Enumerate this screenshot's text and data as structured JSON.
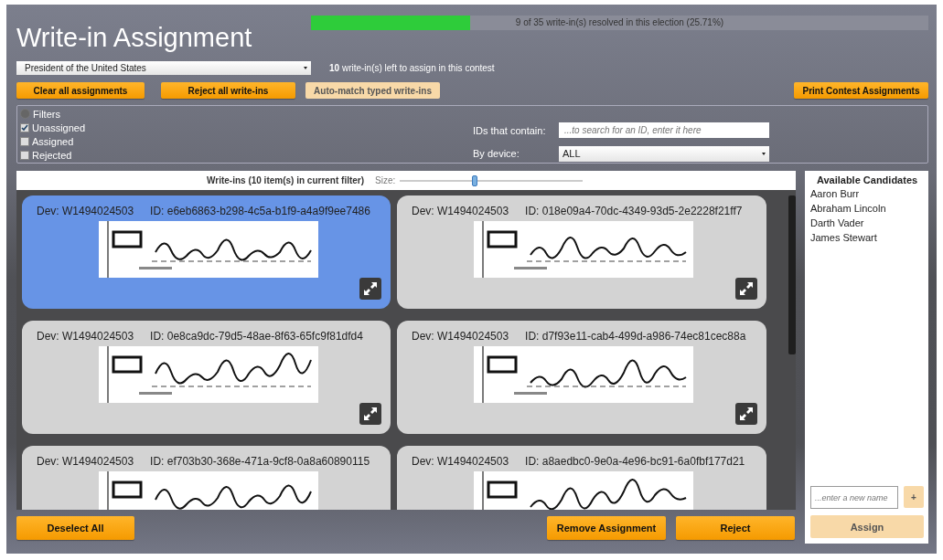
{
  "title": "Write-in Assignment",
  "progress": {
    "level": 0.2571,
    "label": "9 of 35 write-in(s) resolved in this election (25.71%)"
  },
  "contest": {
    "value": "President of the United States"
  },
  "remaining": "**10** write-in(s) left to assign in this contest",
  "actions": [
    {
      "label": "Clear all assignments",
      "disabled": false
    },
    {
      "label": "Reject all write-ins",
      "disabled": false
    },
    {
      "label": "Auto-match typed write-ins",
      "disabled": true
    }
  ],
  "print_button": "Print Contest Assignments",
  "filters": {
    "title": "Filters",
    "selected": false,
    "options": [
      {
        "label": "Unassigned",
        "checked": true
      },
      {
        "label": "Assigned",
        "checked": false
      },
      {
        "label": "Rejected",
        "checked": false
      }
    ]
  },
  "id_search": {
    "label": "IDs that contain:",
    "placeholder": "...to search for an ID, enter it here"
  },
  "device_filter": {
    "label": "By device:",
    "value": "ALL"
  },
  "writeins": {
    "header": "Write-ins (10 item(s) in current filter)",
    "size_label": "Size:",
    "level": 0.41
  },
  "cards": [
    {
      "device": "Dev: W1494024503",
      "id": "ID: e6eb6863-b298-4c5a-b1f9-a4a9f9ee7486",
      "selected": true
    },
    {
      "device": "Dev: W1494024503",
      "id": "ID: 018e09a4-70dc-4349-93d5-2e2228f21ff7",
      "selected": false
    },
    {
      "device": "Dev: W1494024503",
      "id": "ID: 0e8ca9dc-79d5-48ae-8f63-65fc9f81dfd4",
      "selected": false
    },
    {
      "device": "Dev: W1494024503",
      "id": "ID: d7f93e11-cab4-499d-a986-74ec81cec88a",
      "selected": false
    },
    {
      "device": "Dev: W1494024503",
      "id": "ID: ef703b30-368e-471a-9cf8-0a8a60890115",
      "selected": false
    },
    {
      "device": "Dev: W1494024503",
      "id": "ID: a8aedbc0-9e0a-4e96-bc91-6a0fbf177d21",
      "selected": false
    }
  ],
  "candidates": {
    "title": "Available Candidates",
    "items": [
      "Aaron Burr",
      "Abraham Lincoln",
      "Darth Vader",
      "James Stewart"
    ]
  },
  "new_name": {
    "placeholder": "...enter a new name"
  },
  "add_button": "+",
  "assign_button": {
    "label": "Assign",
    "disabled": true
  },
  "bottom_buttons": [
    "Deselect All",
    "Remove Assignment",
    "Reject"
  ]
}
